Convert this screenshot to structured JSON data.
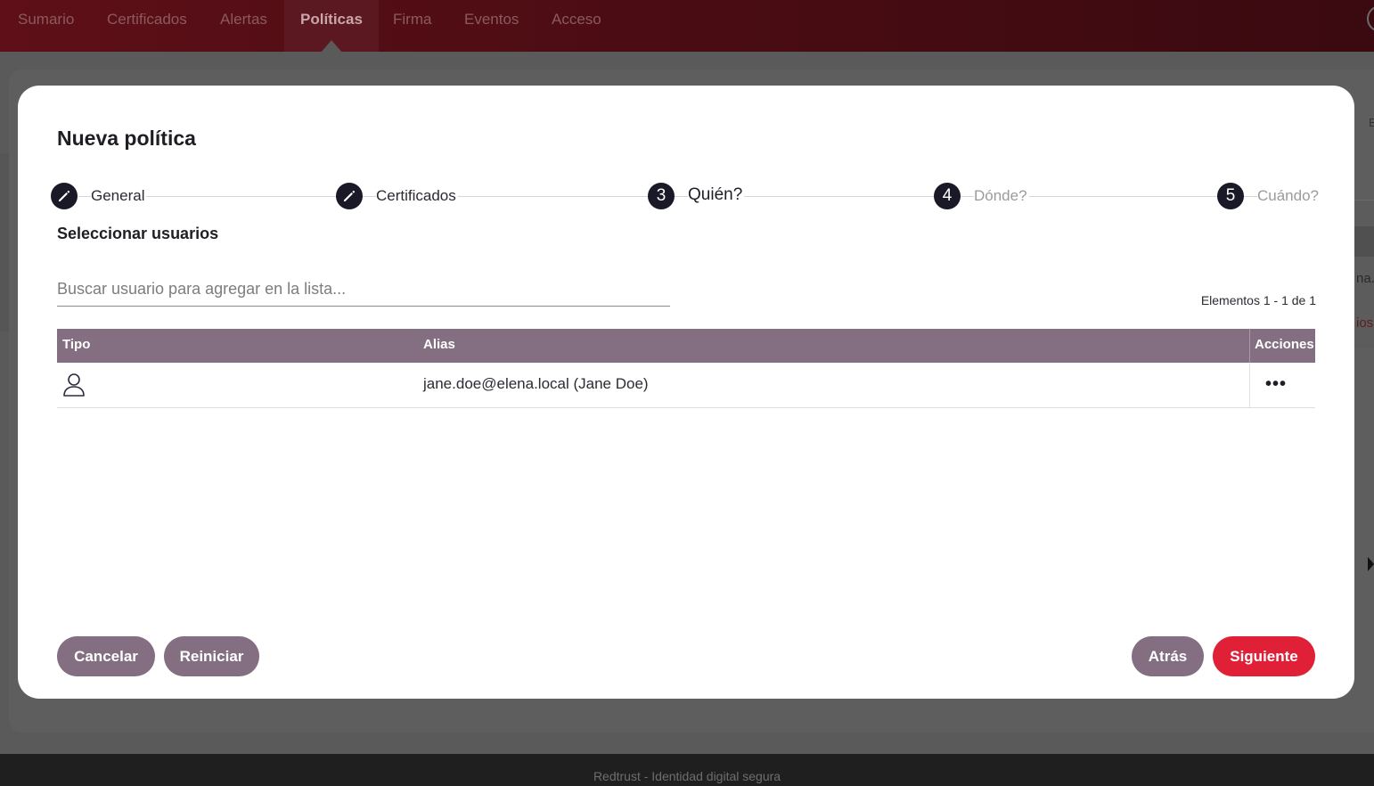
{
  "nav": {
    "items": [
      {
        "label": "Sumario"
      },
      {
        "label": "Certificados"
      },
      {
        "label": "Alertas"
      },
      {
        "label": "Políticas",
        "active": true
      },
      {
        "label": "Firma"
      },
      {
        "label": "Eventos"
      },
      {
        "label": "Acceso"
      }
    ]
  },
  "background": {
    "right_text_1": "na.l",
    "right_text_2": "ios",
    "right_letter": "E"
  },
  "modal": {
    "title": "Nueva política",
    "steps": [
      {
        "label": "General",
        "state": "done",
        "icon": "pencil-icon"
      },
      {
        "label": "Certificados",
        "state": "done",
        "icon": "pencil-icon"
      },
      {
        "label": "Quién?",
        "state": "current",
        "number": "3"
      },
      {
        "label": "Dónde?",
        "state": "upcoming",
        "number": "4"
      },
      {
        "label": "Cuándo?",
        "state": "upcoming",
        "number": "5"
      }
    ],
    "section_title": "Seleccionar usuarios",
    "search": {
      "placeholder": "Buscar usuario para agregar en la lista...",
      "value": ""
    },
    "pager": "Elementos 1 - 1 de 1",
    "table": {
      "columns": [
        "Tipo",
        "Alias",
        "Acciones"
      ],
      "rows": [
        {
          "type_icon": "user-icon",
          "alias": "jane.doe@elena.local (Jane Doe)",
          "actions": "•••"
        }
      ]
    },
    "buttons": {
      "cancel": "Cancelar",
      "reset": "Reiniciar",
      "back": "Atrás",
      "next": "Siguiente"
    }
  },
  "footer": {
    "text": "Redtrust - Identidad digital segura"
  },
  "colors": {
    "nav_bg": "#4a0c13",
    "header_table": "#846f82",
    "primary_button": "#e02036",
    "secondary_button": "#846f82",
    "step_circle": "#191927"
  }
}
